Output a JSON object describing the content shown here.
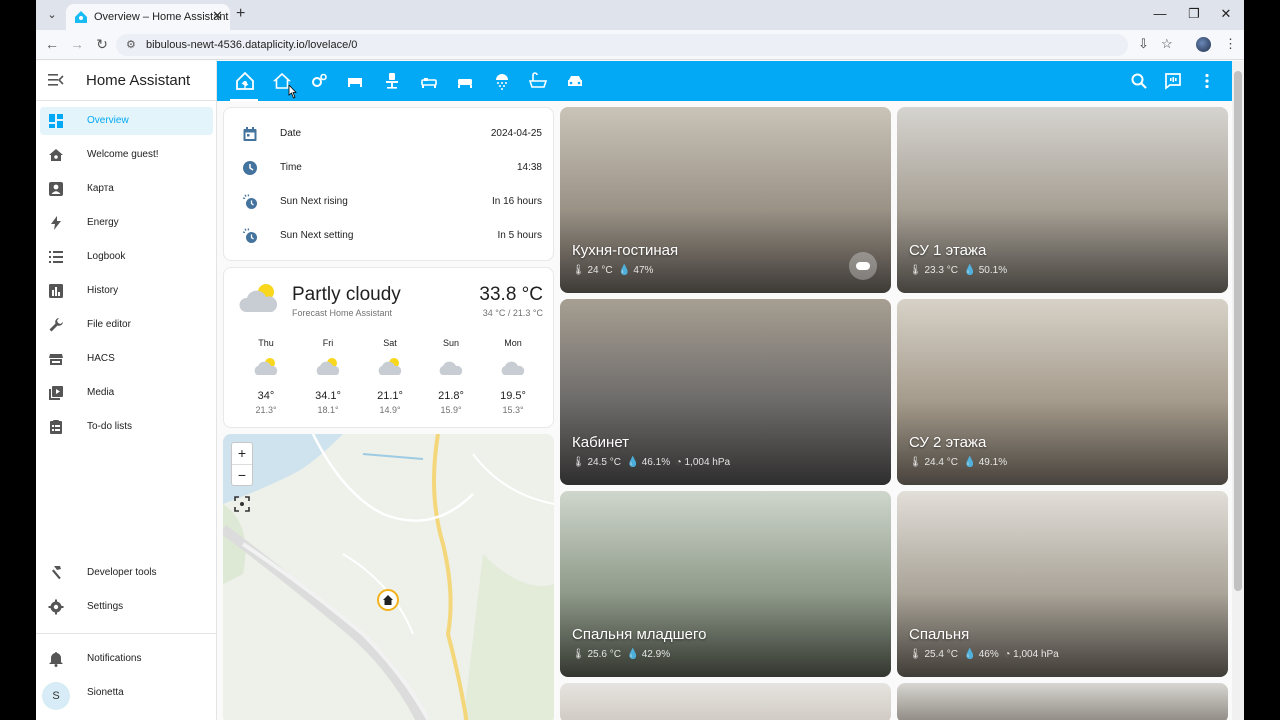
{
  "browser": {
    "tab_title": "Overview – Home Assistant",
    "url": "bibulous-newt-4536.dataplicity.io/lovelace/0"
  },
  "sidebar": {
    "title": "Home Assistant",
    "items": [
      {
        "label": "Overview",
        "icon": "dashboard-icon"
      },
      {
        "label": "Welcome guest!",
        "icon": "home-icon"
      },
      {
        "label": "Карта",
        "icon": "map-account-icon"
      },
      {
        "label": "Energy",
        "icon": "lightning-icon"
      },
      {
        "label": "Logbook",
        "icon": "list-icon"
      },
      {
        "label": "History",
        "icon": "chart-icon"
      },
      {
        "label": "File editor",
        "icon": "wrench-icon"
      },
      {
        "label": "HACS",
        "icon": "hacs-icon"
      },
      {
        "label": "Media",
        "icon": "media-icon"
      },
      {
        "label": "To-do lists",
        "icon": "clipboard-icon"
      }
    ],
    "bottom_items": [
      {
        "label": "Developer tools",
        "icon": "hammer-icon"
      },
      {
        "label": "Settings",
        "icon": "gear-icon"
      }
    ],
    "notifications_label": "Notifications",
    "user_name": "Sionetta",
    "user_initial": "S"
  },
  "info_card": {
    "rows": [
      {
        "label": "Date",
        "value": "2024-04-25",
        "icon": "calendar-icon"
      },
      {
        "label": "Time",
        "value": "14:38",
        "icon": "clock-icon"
      },
      {
        "label": "Sun Next rising",
        "value": "In 16 hours",
        "icon": "sun-clock-icon"
      },
      {
        "label": "Sun Next setting",
        "value": "In 5 hours",
        "icon": "sun-clock-icon"
      }
    ]
  },
  "weather": {
    "condition": "Partly cloudy",
    "source": "Forecast Home Assistant",
    "temperature": "33.8 °C",
    "range": "34 °C / 21.3 °C",
    "forecast": [
      {
        "day": "Thu",
        "high": "34°",
        "low": "21.3°",
        "icon": "partly-cloudy-icon"
      },
      {
        "day": "Fri",
        "high": "34.1°",
        "low": "18.1°",
        "icon": "partly-cloudy-icon"
      },
      {
        "day": "Sat",
        "high": "21.1°",
        "low": "14.9°",
        "icon": "partly-cloudy-icon"
      },
      {
        "day": "Sun",
        "high": "21.8°",
        "low": "15.9°",
        "icon": "cloudy-icon"
      },
      {
        "day": "Mon",
        "high": "19.5°",
        "low": "15.3°",
        "icon": "cloudy-icon"
      }
    ]
  },
  "map": {
    "zoom_in": "+",
    "zoom_out": "−"
  },
  "areas": [
    {
      "name": "Кухня-гостиная",
      "temperature": "24 °C",
      "humidity": "47%",
      "pressure": ""
    },
    {
      "name": "СУ 1 этажа",
      "temperature": "23.3 °C",
      "humidity": "50.1%",
      "pressure": ""
    },
    {
      "name": "Кабинет",
      "temperature": "24.5 °C",
      "humidity": "46.1%",
      "pressure": "1,004 hPa"
    },
    {
      "name": "СУ 2 этажа",
      "temperature": "24.4 °C",
      "humidity": "49.1%",
      "pressure": ""
    },
    {
      "name": "Спальня младшего",
      "temperature": "25.6 °C",
      "humidity": "42.9%",
      "pressure": ""
    },
    {
      "name": "Спальня",
      "temperature": "25.4 °C",
      "humidity": "46%",
      "pressure": "1,004 hPa"
    }
  ],
  "colors": {
    "accent": "#03a9f4",
    "sidebar_active": "#e3f4fb"
  }
}
